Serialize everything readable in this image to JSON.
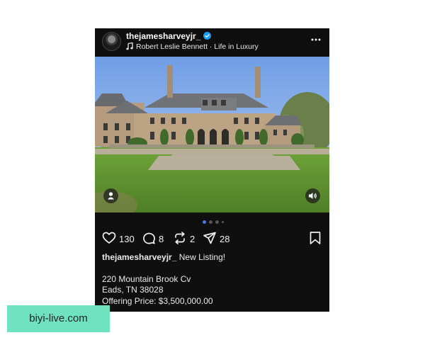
{
  "post": {
    "username": "thejamesharveyjr_",
    "music": "Robert Leslie Bennett · Life in Luxury",
    "photo": {
      "slide_count": 4,
      "active_slide": 1
    },
    "actions": {
      "likes": "130",
      "comments": "8",
      "reposts": "2",
      "shares": "28"
    },
    "caption": {
      "username": "thejamesharveyjr_",
      "text": "New Listing!"
    },
    "address_line1": "220 Mountain Brook Cv",
    "address_line2": "Eads, TN 38028",
    "price_line": "Offering Price: $3,500,000.00"
  },
  "watermark": "biyi-live.com",
  "colors": {
    "background": "#0f0f10",
    "verified_badge": "#1d9bf0",
    "active_dot": "#4c78e0",
    "watermark_bg": "#6fe3c0"
  },
  "icons": [
    "verified-badge-icon",
    "music-note-icon",
    "more-options-icon",
    "person-tag-icon",
    "volume-icon",
    "heart-icon",
    "comment-icon",
    "repost-icon",
    "share-icon",
    "bookmark-icon"
  ]
}
